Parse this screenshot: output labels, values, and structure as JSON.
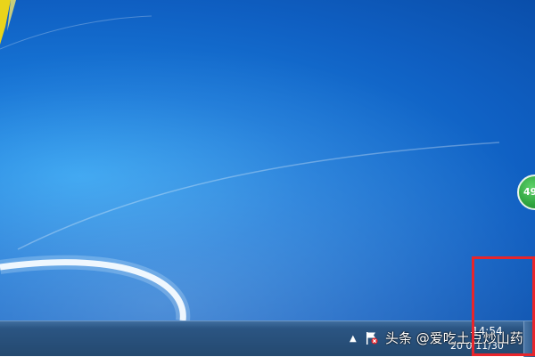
{
  "taskbar": {
    "tray_arrow": "▲",
    "clock_time": "14:54",
    "clock_date": "20 0/11/30"
  },
  "watermark": {
    "text": "头条 @爱吃土豆炒山药"
  },
  "badge": {
    "text": "49"
  },
  "colors": {
    "desktop_blue": "#1878d8",
    "highlight_red": "#e8252b",
    "badge_green": "#2ea23e",
    "logo_yellow": "#e9d41a"
  }
}
